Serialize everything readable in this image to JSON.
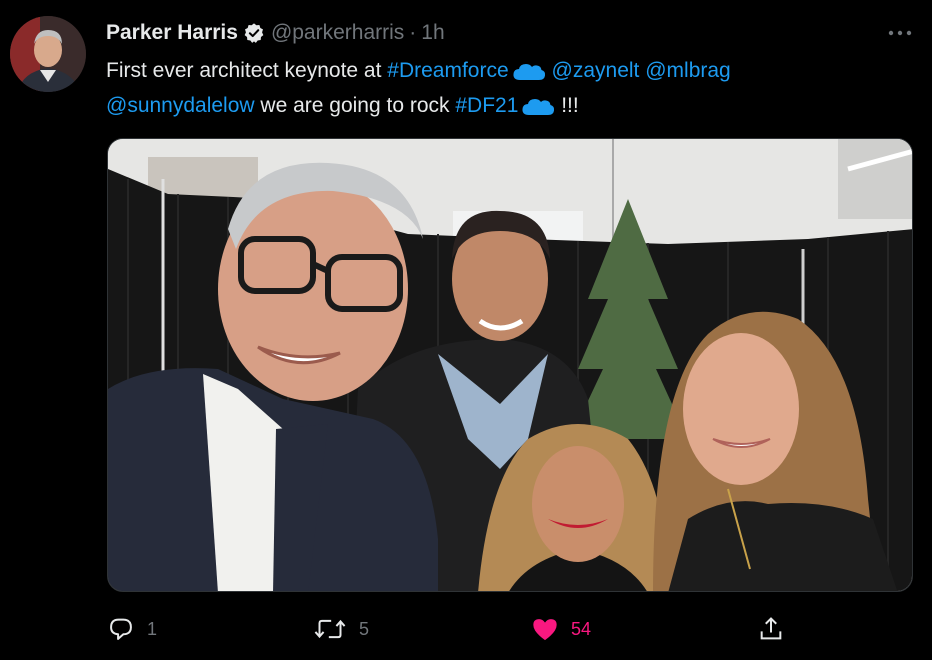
{
  "author": {
    "name": "Parker Harris",
    "handle": "@parkerharris",
    "separator": "·",
    "time": "1h",
    "verified": true
  },
  "tweet": {
    "segments": [
      {
        "text": "First ever architect keynote at ",
        "link": false
      },
      {
        "text": "#Dreamforce",
        "link": true,
        "emoji": "salesforce-cloud-icon"
      },
      {
        "text": " ",
        "link": false
      },
      {
        "text": "@zaynelt",
        "link": true
      },
      {
        "text": " ",
        "link": false
      },
      {
        "text": "@mlbrag",
        "link": true
      },
      {
        "text": " ",
        "link": false
      },
      {
        "text": "@sunnydalelow",
        "link": true
      },
      {
        "text": " we are going to rock ",
        "link": false
      },
      {
        "text": "#DF21",
        "link": true,
        "emoji": "salesforce-cloud-icon"
      },
      {
        "text": " !!!",
        "link": false
      }
    ]
  },
  "actions": {
    "reply_count": "1",
    "retweet_count": "5",
    "like_count": "54",
    "liked": true
  },
  "colors": {
    "background": "#000000",
    "text": "#e7e9ea",
    "muted": "#71767b",
    "link": "#1d9bf0",
    "like": "#f91880"
  },
  "icons": [
    "verified-badge-icon",
    "more-options-icon",
    "salesforce-cloud-icon",
    "reply-icon",
    "retweet-icon",
    "heart-icon",
    "share-icon"
  ]
}
